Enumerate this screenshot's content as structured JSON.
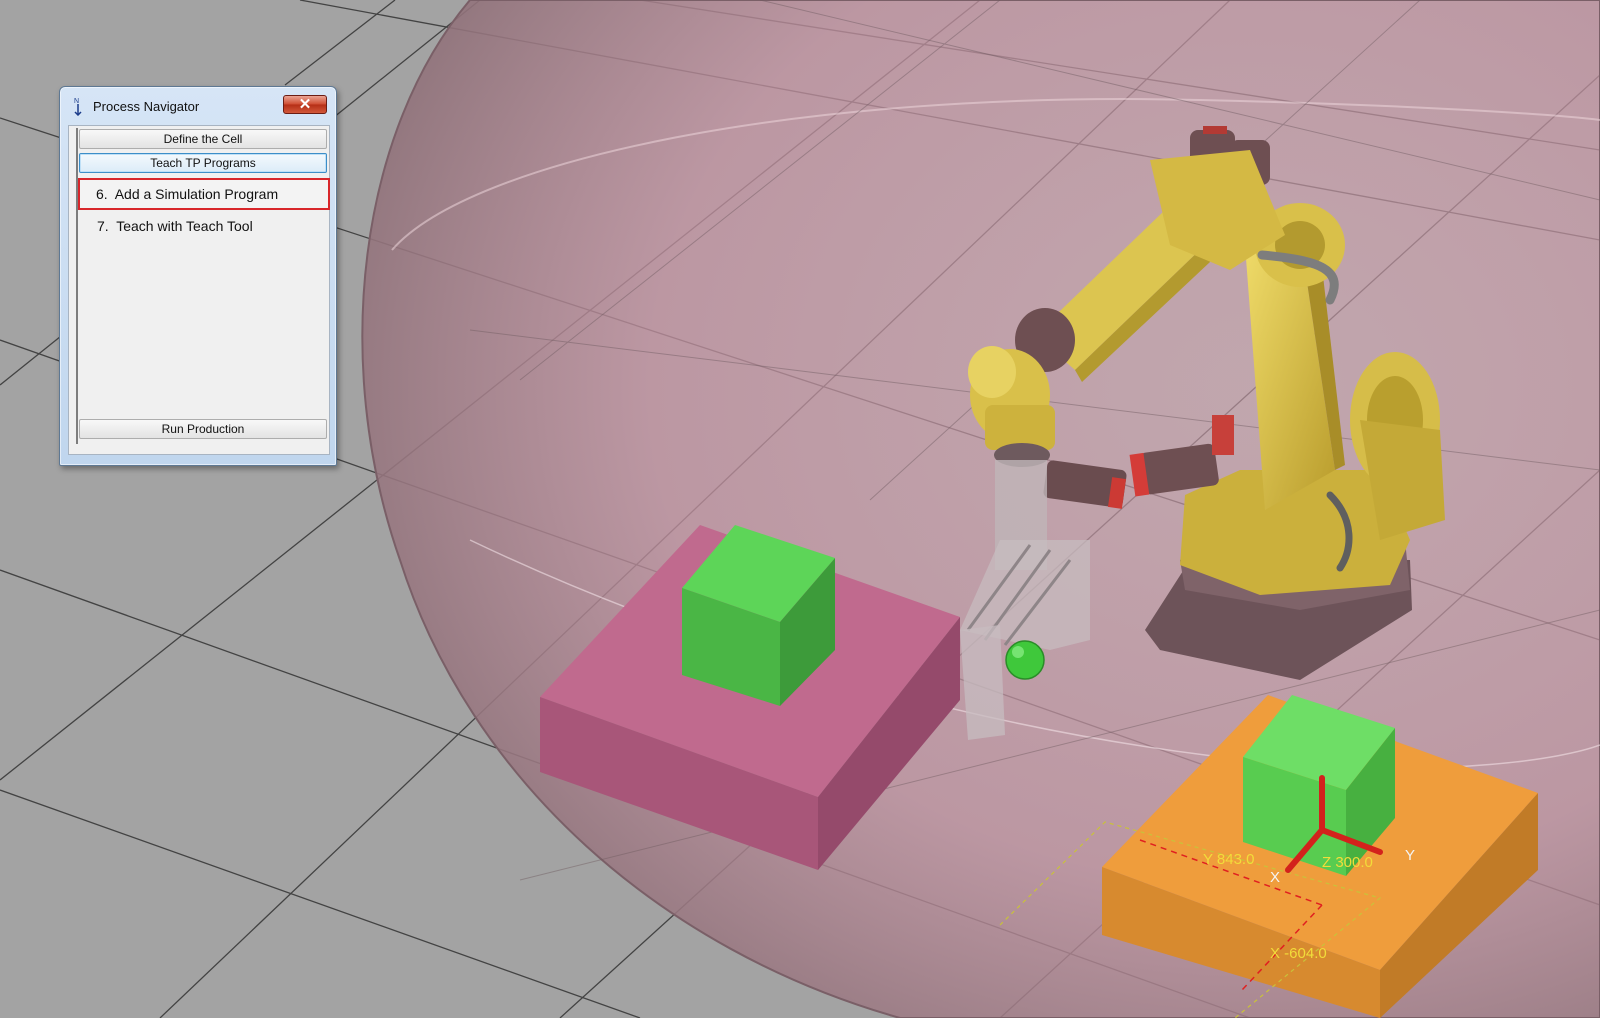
{
  "window": {
    "title": "Process Navigator",
    "close_label": "✕",
    "top_buttons": [
      "Define the Cell",
      "Teach TP Programs"
    ],
    "steps": [
      {
        "number": "6.",
        "label": "Add a Simulation Program",
        "selected": true
      },
      {
        "number": "7.",
        "label": "Teach with Teach Tool",
        "selected": false
      }
    ],
    "bottom_button": "Run Production"
  },
  "viewport": {
    "axis_labels": {
      "x": "X",
      "y": "Y"
    },
    "coordinates": {
      "x": "X -604.0",
      "y": "Y 843.0",
      "z": "Z 300.0"
    }
  },
  "colors": {
    "floor": "#a3a3a3",
    "envelope": "#c497a4",
    "pink_table": "#c06a8e",
    "orange_table": "#ef9d3c",
    "part_green": "#4ec84a",
    "robot_yellow": "#d8c04a",
    "selection_red": "#d8262a"
  }
}
